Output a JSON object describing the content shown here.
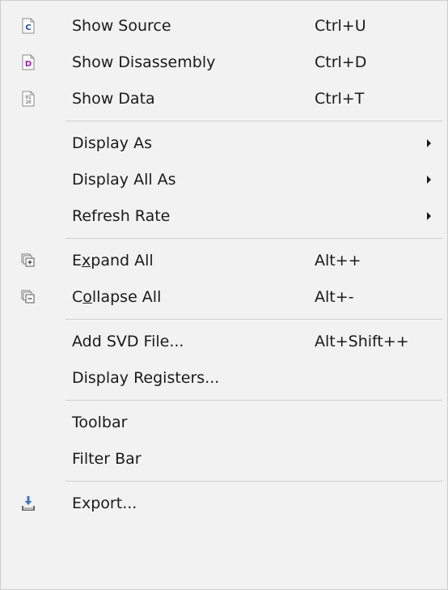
{
  "menu": {
    "show_source": {
      "label": "Show Source",
      "shortcut": "Ctrl+U",
      "icon": "source-c-icon"
    },
    "show_disassembly": {
      "label": "Show Disassembly",
      "shortcut": "Ctrl+D",
      "icon": "disassembly-d-icon"
    },
    "show_data": {
      "label": "Show Data",
      "shortcut": "Ctrl+T",
      "icon": "data-binary-icon"
    },
    "display_as": {
      "label": "Display As"
    },
    "display_all_as": {
      "label": "Display All As"
    },
    "refresh_rate": {
      "label": "Refresh Rate"
    },
    "expand_all": {
      "label_pre": "E",
      "label_ul": "x",
      "label_post": "pand All",
      "shortcut": "Alt++",
      "icon": "expand-all-icon"
    },
    "collapse_all": {
      "label_pre": "C",
      "label_ul": "o",
      "label_post": "llapse All",
      "shortcut": "Alt+-",
      "icon": "collapse-all-icon"
    },
    "add_svd": {
      "label": "Add SVD File...",
      "shortcut": "Alt+Shift++"
    },
    "display_registers": {
      "label": "Display Registers..."
    },
    "toolbar": {
      "label": "Toolbar"
    },
    "filter_bar": {
      "label": "Filter Bar"
    },
    "export": {
      "label": "Export...",
      "icon": "export-icon"
    }
  },
  "colors": {
    "background": "#f2f2f2",
    "separator": "#d0d0d0",
    "text": "#1a1a1a"
  }
}
